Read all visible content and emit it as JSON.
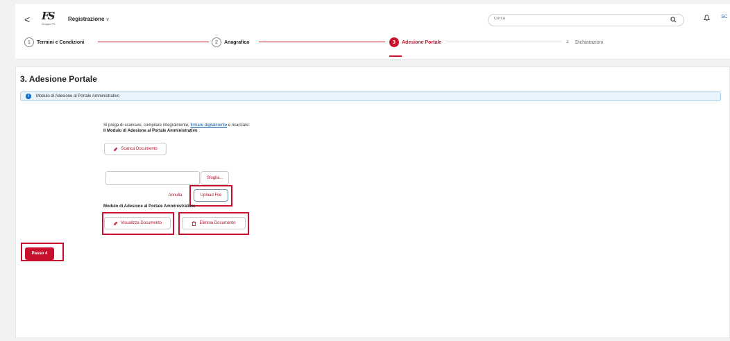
{
  "header": {
    "back_glyph": "<",
    "logo_mark": "FS",
    "logo_caption": "Gruppo FS",
    "app_title": "Registrazione",
    "app_title_chevron": "∨",
    "search_placeholder": "Cerca",
    "avatar_initials": "SC"
  },
  "stepper": {
    "steps": [
      {
        "number": "1",
        "label": "Termini e Condizioni",
        "state": "done"
      },
      {
        "number": "2",
        "label": "Anagrafica",
        "state": "done"
      },
      {
        "number": "3",
        "label": "Adesione Portale",
        "state": "active"
      },
      {
        "number": "4",
        "label": "Dichiarazioni",
        "state": "pending"
      }
    ]
  },
  "section": {
    "title": "3. Adesione Portale",
    "info_text": "Modulo di Adesione al Portale Amministrativo",
    "instruction_prefix": "Si prega di scaricare, compilare integralmente, ",
    "instruction_link": "firmare digitalmente",
    "instruction_suffix": " e ricaricare:",
    "instruction_bold": "Il Modulo di Adesione al Portale Amministrativo",
    "download_button": "Scarica Documento",
    "browse_button": "Sfoglia...",
    "file_value": "",
    "cancel_button": "Annulla",
    "upload_button": "Upload File",
    "uploaded_label": "Modulo di Adesione al Portale Amministrativo:",
    "view_button": "Visualizza Documento",
    "delete_button": "Elimina Documento",
    "next_button": "Passo 4"
  },
  "colors": {
    "accent": "#c8102e",
    "info_bg": "#e8f3fb",
    "info_icon": "#0a6ed1",
    "link": "#0a4f9c"
  },
  "icons": {
    "back": "chevron-left-icon",
    "search": "search-icon",
    "notifications": "bell-icon",
    "info": "info-icon",
    "download": "paperclip-icon",
    "view": "paperclip-icon",
    "delete": "trash-icon"
  }
}
